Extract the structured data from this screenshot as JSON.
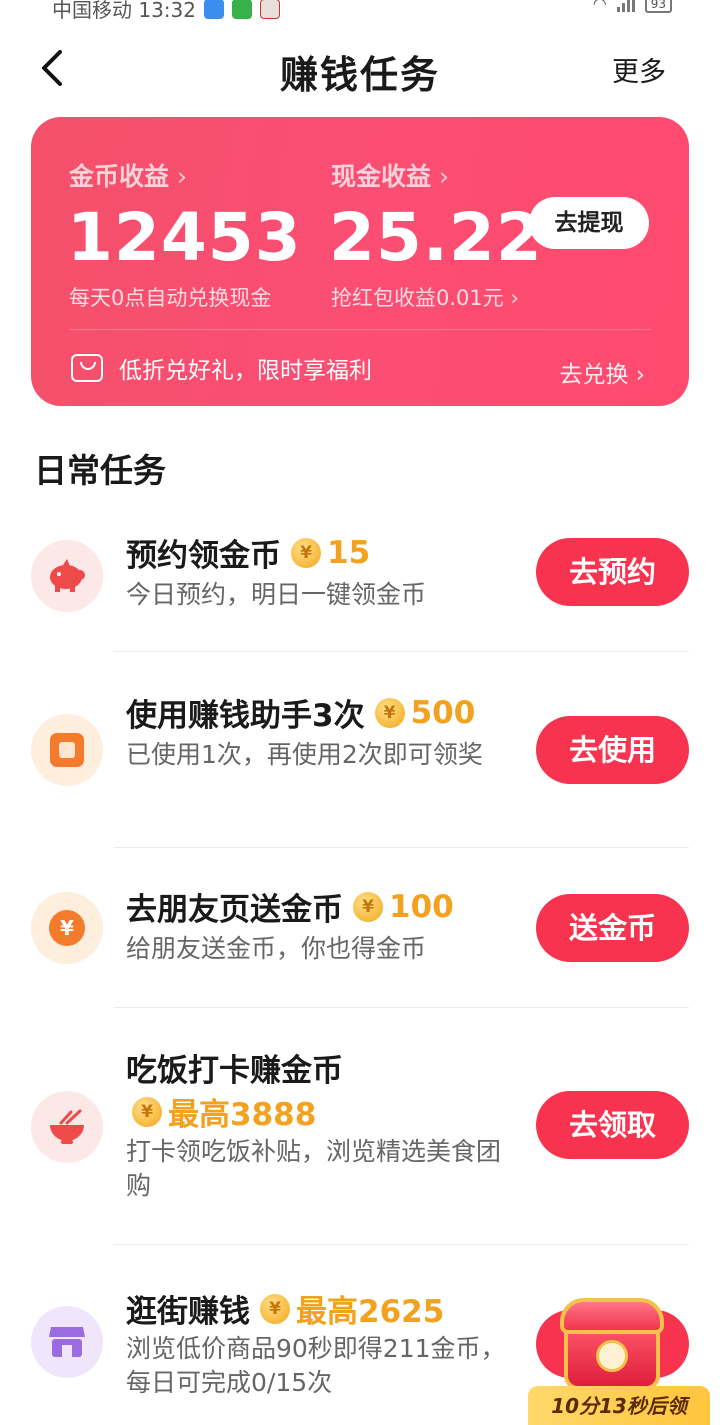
{
  "status_bar": {
    "carrier_time": "中国移动 13:32",
    "battery": "93"
  },
  "header": {
    "title": "赚钱任务",
    "more": "更多"
  },
  "earnings": {
    "coin_label": "金币收益",
    "coin_value": "12453",
    "coin_sub": "每天0点自动兑换现金",
    "cash_label": "现金收益",
    "cash_value": "25.22",
    "cash_sub": "抢红包收益0.01元",
    "withdraw_button": "去提现",
    "promo_text": "低折兑好礼，限时享福利",
    "redeem_link": "去兑换"
  },
  "section": {
    "title": "日常任务"
  },
  "coin_symbol": "¥",
  "tasks": [
    {
      "name": "预约领金币",
      "reward": "15",
      "desc": "今日预约，明日一键领金币",
      "button": "去预约",
      "icon": "piggy-bank-icon",
      "color": "#fde8e8"
    },
    {
      "name": "使用赚钱助手3次",
      "reward": "500",
      "desc": "已使用1次，再使用2次即可领奖",
      "button": "去使用",
      "icon": "assistant-icon",
      "color": "#fdeede"
    },
    {
      "name": "去朋友页送金币",
      "reward": "100",
      "desc": "给朋友送金币，你也得金币",
      "button": "送金币",
      "icon": "yuan-coin-icon",
      "color": "#fdeede"
    },
    {
      "name": "吃饭打卡赚金币",
      "reward": "最高3888",
      "desc": "打卡领吃饭补贴，浏览精选美食团购",
      "button": "去领取",
      "icon": "bowl-icon",
      "color": "#fde8e8"
    },
    {
      "name": "逛街赚钱",
      "reward": "最高2625",
      "desc": "浏览低价商品90秒即得211金币，每日可完成0/15次",
      "button": "",
      "icon": "shop-icon",
      "color": "#efe6fb"
    }
  ],
  "chest": {
    "timer": "10分13秒后领"
  },
  "colors": {
    "accent": "#f8334f",
    "card": "#fb4e73",
    "reward": "#f2a21f"
  }
}
